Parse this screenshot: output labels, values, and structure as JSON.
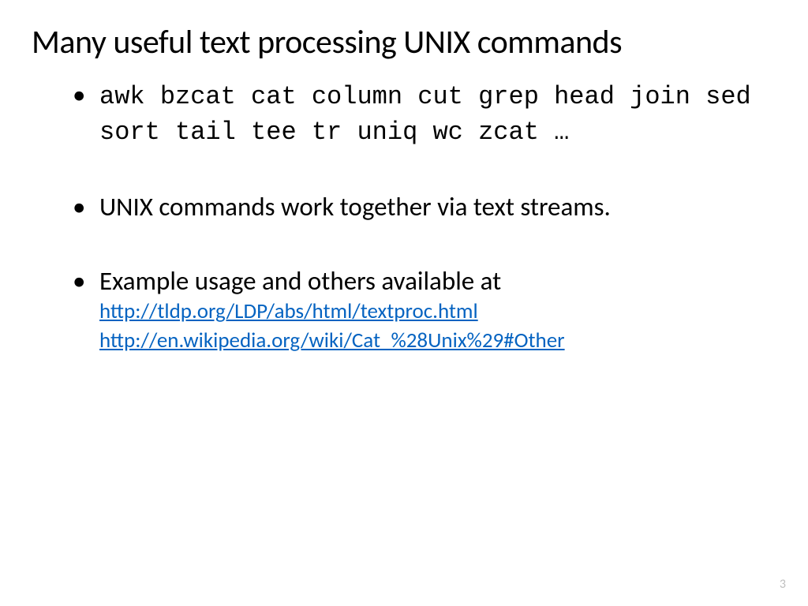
{
  "title": "Many useful text processing UNIX commands",
  "bullets": {
    "b1_commands": "awk bzcat cat column cut grep head join sed sort tail tee tr uniq wc zcat …",
    "b2_text": "UNIX commands work together via text streams.",
    "b3_text": "Example usage and others available at",
    "b3_link1": "http://tldp.org/LDP/abs/html/textproc.html",
    "b3_link2": "http://en.wikipedia.org/wiki/Cat_%28Unix%29#Other"
  },
  "page_number": "3"
}
